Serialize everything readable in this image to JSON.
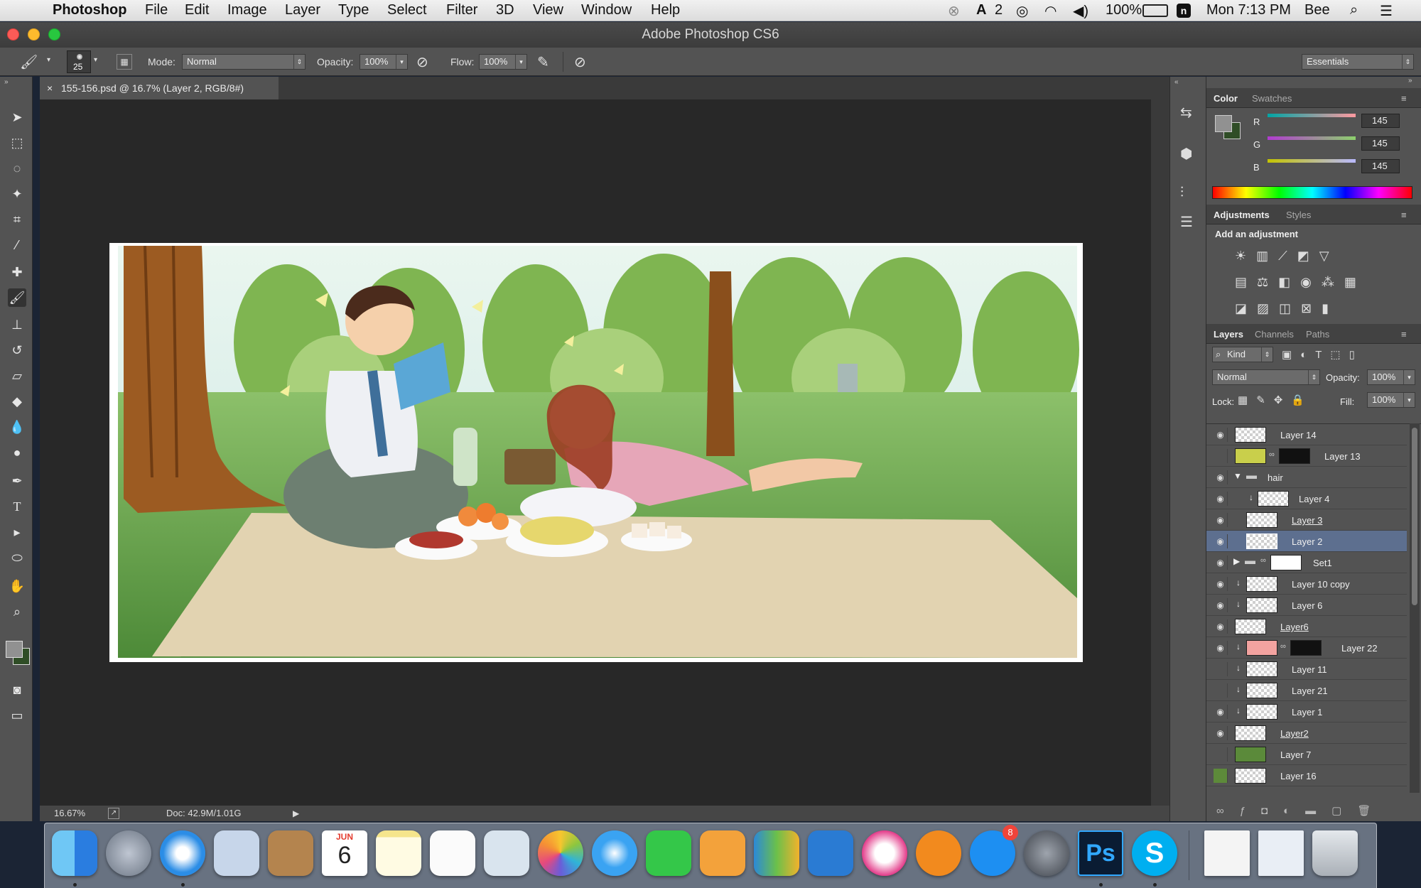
{
  "menubar": {
    "app_name": "Photoshop",
    "items": [
      "File",
      "Edit",
      "Image",
      "Layer",
      "Type",
      "Select",
      "Filter",
      "3D",
      "View",
      "Window",
      "Help"
    ],
    "status": {
      "adobe_count": "2",
      "battery": "100%",
      "clock": "Mon 7:13 PM",
      "user": "Bee"
    }
  },
  "window": {
    "title": "Adobe Photoshop CS6"
  },
  "options": {
    "brush_size": "25",
    "mode_label": "Mode:",
    "mode_value": "Normal",
    "opacity_label": "Opacity:",
    "opacity_value": "100%",
    "flow_label": "Flow:",
    "flow_value": "100%",
    "workspace": "Essentials"
  },
  "document": {
    "tab_title": "155-156.psd @ 16.7% (Layer 2, RGB/8#)",
    "zoom": "16.67%",
    "doc_size": "Doc: 42.9M/1.01G"
  },
  "color_panel": {
    "tabs": [
      "Color",
      "Swatches"
    ],
    "channels": [
      {
        "name": "R",
        "value": "145"
      },
      {
        "name": "G",
        "value": "145"
      },
      {
        "name": "B",
        "value": "145"
      }
    ]
  },
  "adjustments_panel": {
    "tabs": [
      "Adjustments",
      "Styles"
    ],
    "heading": "Add an adjustment"
  },
  "layers_panel": {
    "tabs": [
      "Layers",
      "Channels",
      "Paths"
    ],
    "kind_label": "Kind",
    "blend_mode": "Normal",
    "opacity_label": "Opacity:",
    "opacity_value": "100%",
    "lock_label": "Lock:",
    "fill_label": "Fill:",
    "fill_value": "100%",
    "layers": [
      {
        "name": "Layer 14",
        "visible": true
      },
      {
        "name": "Layer 13",
        "visible": false
      },
      {
        "name": "hair",
        "visible": true
      },
      {
        "name": "Layer 4",
        "visible": true
      },
      {
        "name": "Layer 3",
        "visible": true
      },
      {
        "name": "Layer 2",
        "visible": true,
        "selected": true
      },
      {
        "name": "Set1",
        "visible": true
      },
      {
        "name": "Layer 10 copy",
        "visible": true
      },
      {
        "name": "Layer 6",
        "visible": true
      },
      {
        "name": "Layer6",
        "visible": true
      },
      {
        "name": "Layer 22",
        "visible": true
      },
      {
        "name": "Layer 11",
        "visible": false
      },
      {
        "name": "Layer 21",
        "visible": false
      },
      {
        "name": "Layer 1",
        "visible": true
      },
      {
        "name": "Layer2",
        "visible": true
      },
      {
        "name": "Layer 7",
        "visible": false
      },
      {
        "name": "Layer 16",
        "visible": false
      }
    ]
  },
  "dock": {
    "calendar_month": "JUN",
    "calendar_day": "6",
    "appstore_badge": "8",
    "apps": [
      "Finder",
      "Launchpad",
      "Safari",
      "Mail",
      "Contacts",
      "Calendar",
      "Notes",
      "Reminders",
      "Photo Booth",
      "Photos",
      "Messages",
      "FaceTime",
      "Pages",
      "Numbers",
      "Keynote",
      "iTunes",
      "iBooks",
      "App Store",
      "System Preferences",
      "Photoshop",
      "Skype",
      "Preview",
      "Image",
      "Trash"
    ]
  },
  "colors": {
    "accent_selected": "#5d6f8f",
    "fg_color": "#919191",
    "bg_color": "#2f4d26"
  }
}
